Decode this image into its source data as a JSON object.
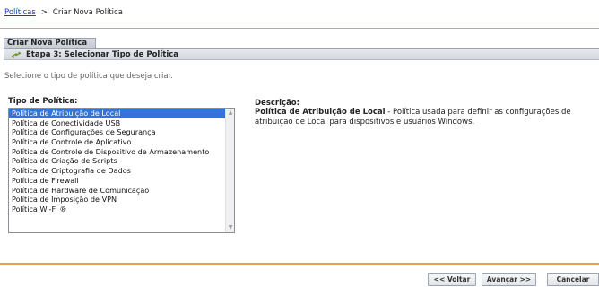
{
  "breadcrumb": {
    "root": "Políticas",
    "separator": ">",
    "current": "Criar Nova Política"
  },
  "panel": {
    "title": "Criar Nova Política",
    "step_title": "Etapa 3: Selecionar Tipo de Política",
    "step_icon": "wizard-arrow-icon"
  },
  "instruction": "Selecione o tipo de política que deseja criar.",
  "policy_type": {
    "label": "Tipo de Política:",
    "items": [
      "Política de Atribuição de Local",
      "Política de Conectividade USB",
      "Política de Configurações de Segurança",
      "Política de Controle de Aplicativo",
      "Política de Controle de Dispositivo de Armazenamento",
      "Política de Criação de Scripts",
      "Política de Criptografia de Dados",
      "Política de Firewall",
      "Política de Hardware de Comunicação",
      "Política de Imposição de VPN",
      "Política Wi-Fi ®"
    ],
    "selected_index": 0
  },
  "description": {
    "label": "Descrição:",
    "name": "Política de Atribuição de Local",
    "text": " - Política usada para definir as configurações de atribuição de Local para dispositivos e usuários Windows."
  },
  "buttons": {
    "back": "<< Voltar",
    "next": "Avançar >>",
    "cancel": "Cancelar"
  },
  "colors": {
    "accent_rule": "#e8a24a",
    "link": "#1a3fa8",
    "selection": "#3474d6"
  }
}
